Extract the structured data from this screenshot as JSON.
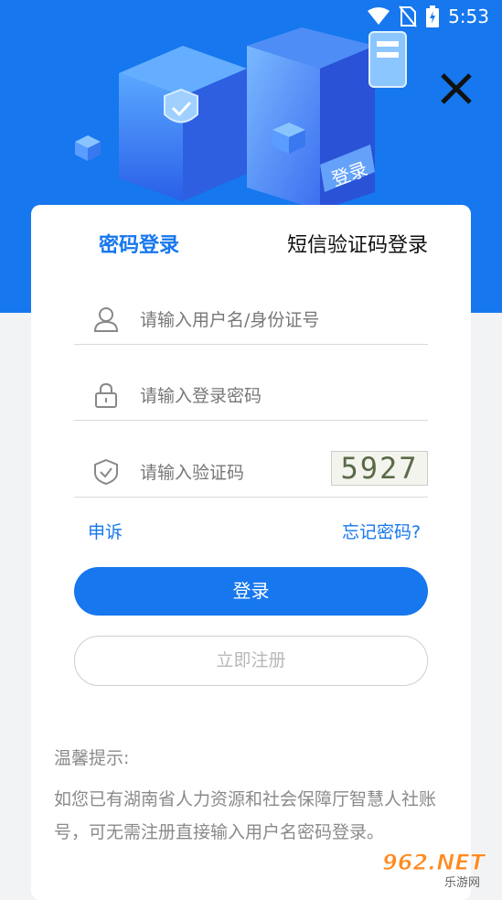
{
  "status_bar": {
    "time": "5:53"
  },
  "header": {
    "illustration_text": "登录"
  },
  "tabs": {
    "password_login": "密码登录",
    "sms_login": "短信验证码登录"
  },
  "form": {
    "username_placeholder": "请输入用户名/身份证号",
    "password_placeholder": "请输入登录密码",
    "captcha_placeholder": "请输入验证码",
    "captcha_code": "5927"
  },
  "links": {
    "appeal": "申诉",
    "forgot_password": "忘记密码?"
  },
  "buttons": {
    "login": "登录",
    "register": "立即注册"
  },
  "tips": {
    "title": "温馨提示:",
    "body": "如您已有湖南省人力资源和社会保障厅智慧人社账号，可无需注册直接输入用户名密码登录。"
  },
  "watermark": {
    "brand": "962.NET",
    "sub": "乐游网"
  },
  "colors": {
    "primary": "#1677ee",
    "background": "#f2f3f5"
  }
}
